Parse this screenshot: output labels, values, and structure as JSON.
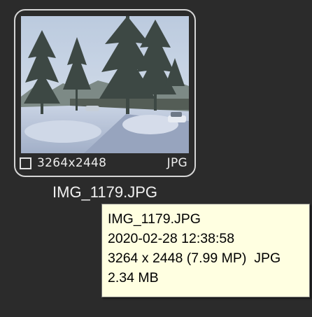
{
  "thumbnail": {
    "resolution": "3264x2448",
    "file_type": "JPG",
    "image_alt": "Snowy landscape with pine trees and parked cars",
    "selected": false
  },
  "file_name": "IMG_1179.JPG",
  "tooltip": {
    "name": "IMG_1179.JPG",
    "date": "2020-02-28 12:38:58",
    "dimensions": "3264 x 2448 (7.99 MP)  JPG",
    "size": "2.34 MB"
  },
  "colors": {
    "background": "#2b2b2b",
    "card_border": "#d6d6d6",
    "tooltip_background": "#ffffe1",
    "tooltip_border": "#767676"
  }
}
